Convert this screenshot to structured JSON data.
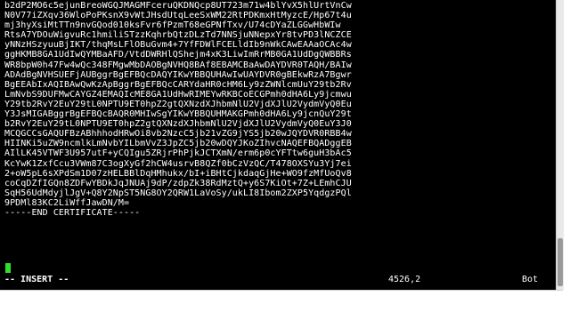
{
  "editor": {
    "lines": [
      "b2dP2MO6c5ejunBreoWGQJMAGMFceruQKDNQcp8UT723m71w4blYvX5hlUrtVnCw",
      "N0V77iZXqv36WloPoPKsnX9vWtJHsdUtqLeeSxWM22RtPDKmxHtMyzcE/Hp67t4u",
      "mj3hyXsiMtTTn9nvGQod010ksFvr6fPzmT68eGPNfTxv/U74cDYaZLGGwHbWIw",
      "RtsA7YDOuWigvuRc1hmiliSTzzKqhrbQtzDLzTd7NNSjuNNepxYr8tvPD3lNCZCE",
      "yNNzHSzyuuBjIKT/thqMsLFlOBuGvm4+7YfFDWlFCELldIb9nWkCAwEAAaOCAc4w",
      "ggHKMB8GA1UdIwQYMBaAFD/VtdDWRHlQShejm4xK3LiwImRrMB0GA1UdDgQWBBRs",
      "WR8bpW0h47Fw4wQc348FMgwMbDAOBgNVHQ8BAf8EBAMCBaAwDAYDVR0TAQH/BAIw",
      "ADAdBgNVHSUEFjAUBggrBgEFBQcDAQYIKwYBBQUHAwIwUAYDVR0gBEkwRzA7Bgwr",
      "BgEEAbIxAQIBAwQwKzApBggrBgEFBQcCARYdaHR0cHM6Ly9zZWNlcmUuY29tb2Rv",
      "LmNvbS9DUFMwCAYGZ4EMAQIcME8GA1UdHwRIMEYwRKBCoECGPmh0dHA6Ly9jcmwu",
      "Y29tb2RvY2EuY29tL0NPTU9ET0hpZ2gtQXNzdXJhbmNlU2VjdXJlU2VydmVyQ0Eu",
      "Y3JsMIGABggrBgEFBQcBAQR0MHIwSgYIKwYBBQUHMAKGPmh0dHA6Ly9jcnQuY29t",
      "b2RvY2EuY29tL0NPTU9ET0hpZ2gtQXNzdXJhbmNlU2VjdXJlU2VydmVyQ0EuY3J0",
      "MCQGCCsGAQUFBzABhhhodHRwOi8vb2NzcC5jb21vZG9jYS5jb20wJQYDVR0RBB4w",
      "HIINKi5uZW9ncmlkLmNvbYILbmVvZ3JpZC5jb20wDQYJKoZIhvcNAQEFBQADggEB",
      "AIlLK45VTWF3U957utF+yCQIgu5ZRjrPhPjkJCTXmN/erm6p0cYFTtw6guH3bAc5",
      "KcYwK1ZxfCcu3VWm87C3ogXyGf2hCW4usrvB8QZf0bCzVzQC/T478OXSYu3Yj7ei",
      "2+oW5pL6sXPdSm1D07zHELBBlDqHMhukx/bI+iBHtCjkdaqGjHe+WO9fzMfUoQv8",
      "coCqDZfIGQn8ZDFwYBDkJqJNUAj9dP/zdpZk38RdMztQ+y6S7KiOt+7Z+LEmhCJU",
      "SqH56UdMdyjlJgV+Q8Y2NpST5NG8OY2QRW1LaVoSy/ukLI8Ibom2ZXP5YqdgzPQl",
      "9PDMl83KC2LiWffJawDN/M=",
      "-----END CERTIFICATE-----",
      "",
      "",
      "",
      ""
    ],
    "cursor_char": " ",
    "mode_label": "-- INSERT --",
    "cursor_position": "4526,2",
    "scroll_position": "Bot"
  },
  "colors": {
    "background": "#000000",
    "text": "#ffffff",
    "cursor": "#2ee02e"
  }
}
